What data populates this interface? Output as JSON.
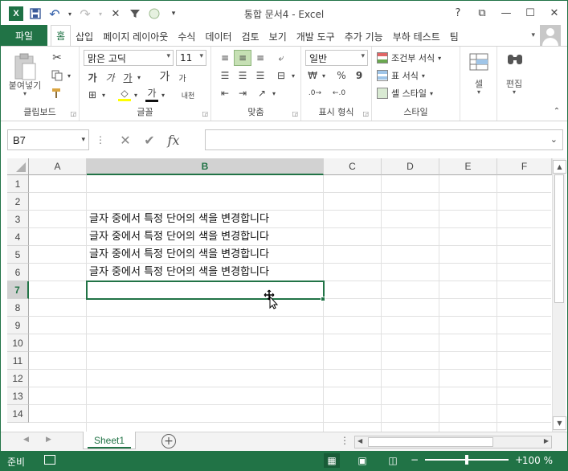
{
  "window": {
    "title": "통합 문서4 - Excel",
    "controls": {
      "help": "?",
      "ribbon_display": "⧉",
      "minimize": "—",
      "maximize": "☐",
      "close": "✕"
    }
  },
  "qat": {
    "logo": "X",
    "save": "💾",
    "undo": "↶",
    "redo": "↷",
    "clear": "✕",
    "filter": "⏷",
    "circle": "◯",
    "customize": "▾"
  },
  "tabs": [
    "파일",
    "홈",
    "삽입",
    "페이지 레이아웃",
    "수식",
    "데이터",
    "검토",
    "보기",
    "개발 도구",
    "추가 기능",
    "부하 테스트",
    "팀"
  ],
  "active_tab": "홈",
  "ribbon": {
    "clipboard": {
      "label": "클립보드",
      "paste": "붙여넣기"
    },
    "font": {
      "label": "글꼴",
      "font_name": "맑은 고딕",
      "font_size": "11",
      "bold": "가",
      "italic": "가",
      "underline": "가",
      "grow": "가",
      "shrink": "가",
      "border": "⊞",
      "fill": "◇",
      "font_color": "가",
      "phonetic": "내천"
    },
    "alignment": {
      "label": "맞춤"
    },
    "number": {
      "label": "표시 형식",
      "format": "일반",
      "currency": "₩",
      "percent": "%",
      "comma": "9"
    },
    "styles": {
      "label": "스타일",
      "conditional": "조건부 서식",
      "table": "표 서식",
      "cell": "셀 스타일"
    },
    "cells": {
      "label": "셀"
    },
    "editing": {
      "label": "편집"
    }
  },
  "formula_bar": {
    "name_box": "B7",
    "cancel": "✕",
    "enter": "✔",
    "fx": "fx",
    "formula": ""
  },
  "columns": [
    "A",
    "B",
    "C",
    "D",
    "E",
    "F"
  ],
  "selected_column": "B",
  "rows": [
    "1",
    "2",
    "3",
    "4",
    "5",
    "6",
    "7",
    "8",
    "9",
    "10",
    "11",
    "12",
    "13",
    "14"
  ],
  "selected_row": "7",
  "cells": [
    {
      "ref": "B3",
      "value": "글자 중에서 특정 단어의 색을 변경합니다"
    },
    {
      "ref": "B4",
      "value": "글자 중에서 특정 단어의 색을 변경합니다"
    },
    {
      "ref": "B5",
      "value": "글자 중에서 특정 단어의 색을 변경합니다"
    },
    {
      "ref": "B6",
      "value": "글자 중에서 특정 단어의 색을 변경합니다"
    }
  ],
  "sheets": [
    "Sheet1"
  ],
  "active_sheet": "Sheet1",
  "status": {
    "ready": "준비",
    "zoom": "100 %"
  }
}
